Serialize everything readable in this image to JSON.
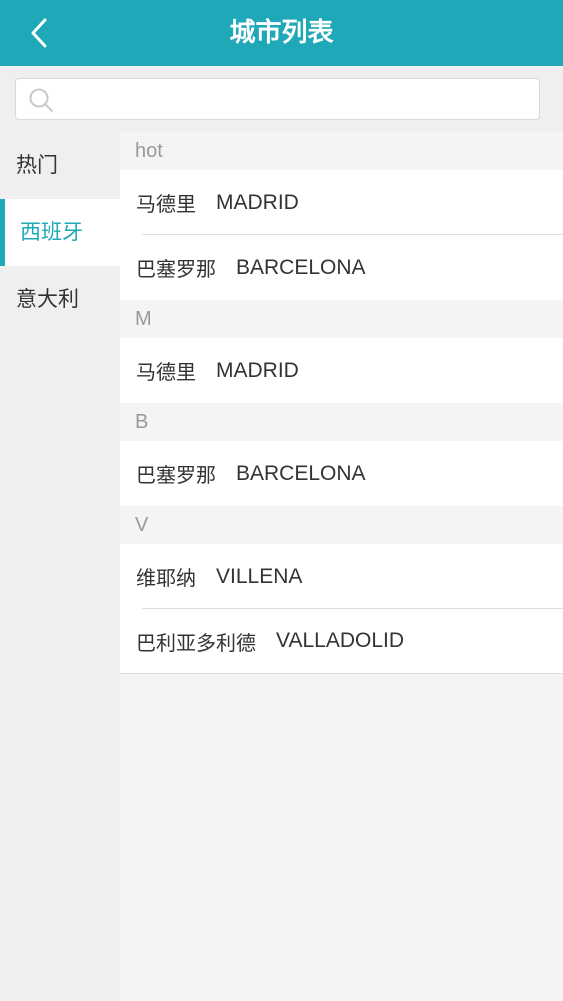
{
  "header": {
    "title": "城市列表",
    "back_icon": "chevron-left-icon",
    "color": "#1ea8b8"
  },
  "search": {
    "value": "",
    "placeholder": "",
    "icon": "search-icon"
  },
  "sidebar": {
    "items": [
      {
        "label": "热门",
        "active": false
      },
      {
        "label": "西班牙",
        "active": true
      },
      {
        "label": "意大利",
        "active": false
      }
    ]
  },
  "sections": [
    {
      "header": "hot",
      "cities": [
        {
          "zh": "马德里",
          "en": "MADRID"
        },
        {
          "zh": "巴塞罗那",
          "en": "BARCELONA"
        }
      ]
    },
    {
      "header": "M",
      "cities": [
        {
          "zh": "马德里",
          "en": "MADRID"
        }
      ]
    },
    {
      "header": "B",
      "cities": [
        {
          "zh": "巴塞罗那",
          "en": "BARCELONA"
        }
      ]
    },
    {
      "header": "V",
      "cities": [
        {
          "zh": "维耶纳",
          "en": "VILLENA"
        },
        {
          "zh": "巴利亚多利德",
          "en": "VALLADOLID"
        }
      ]
    }
  ]
}
